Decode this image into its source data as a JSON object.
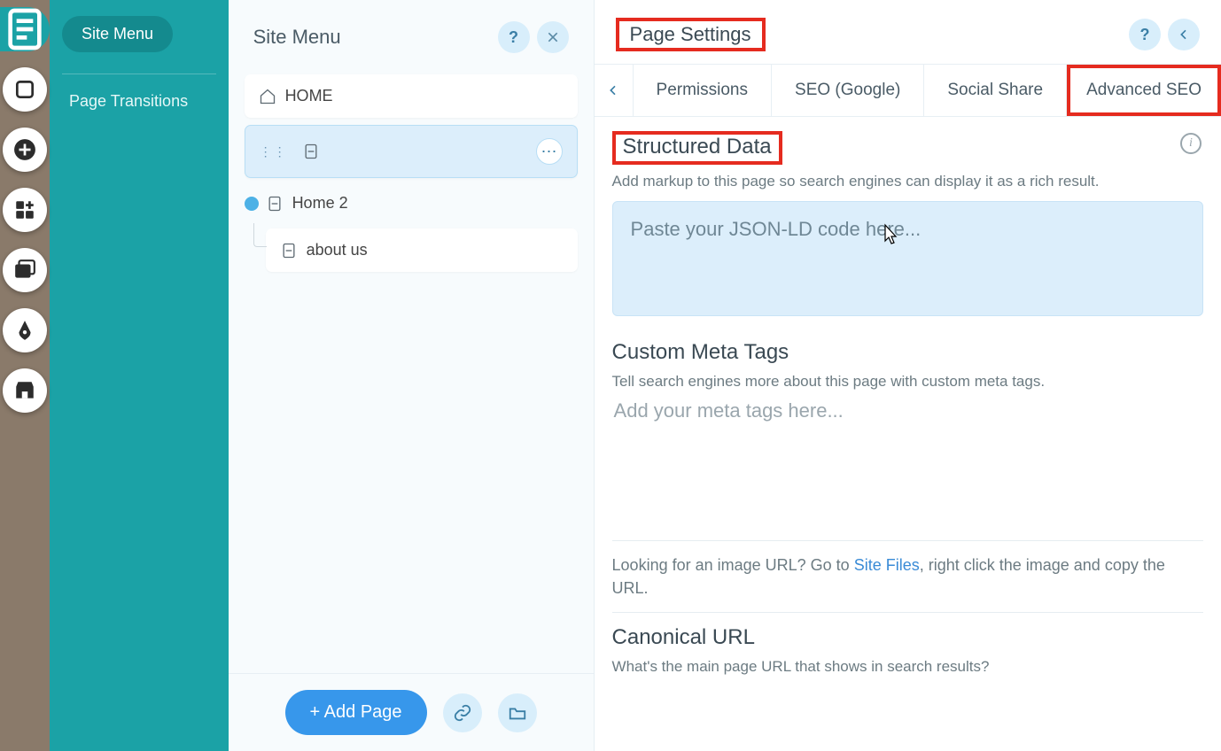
{
  "leftRail": {
    "topIcon": "pages-icon",
    "buttons": [
      "background-icon",
      "add-icon",
      "apps-icon",
      "media-icon",
      "blog-icon",
      "bookings-icon"
    ]
  },
  "tealSidebar": {
    "activePill": "Site Menu",
    "link": "Page Transitions"
  },
  "sitePanel": {
    "title": "Site Menu",
    "pages": {
      "home": "HOME",
      "selectedLabel": "",
      "home2": "Home 2",
      "about": "about us"
    },
    "addPage": "+ Add Page"
  },
  "settings": {
    "title": "Page Settings",
    "tabs": {
      "permissions": "Permissions",
      "seo": "SEO (Google)",
      "social": "Social Share",
      "advanced": "Advanced SEO"
    },
    "structured": {
      "title": "Structured Data",
      "desc": "Add markup to this page so search engines can display it as a rich result.",
      "placeholder": "Paste your JSON-LD code here..."
    },
    "meta": {
      "title": "Custom Meta Tags",
      "desc": "Tell search engines more about this page with custom meta tags.",
      "placeholder": "Add your meta tags here..."
    },
    "imageHint": {
      "pre": "Looking for an image URL? Go to ",
      "link": "Site Files",
      "post": ", right click the image and copy the URL."
    },
    "canonical": {
      "title": "Canonical URL",
      "desc": "What's the main page URL that shows in search results?"
    }
  }
}
